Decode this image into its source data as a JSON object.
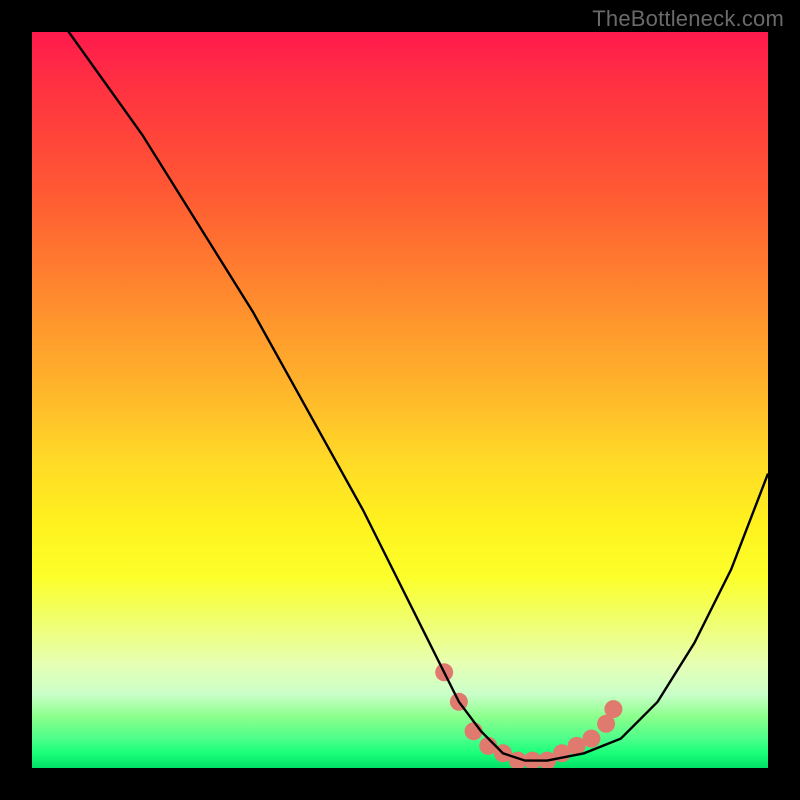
{
  "watermark": "TheBottleneck.com",
  "chart_data": {
    "type": "line",
    "title": "",
    "xlabel": "",
    "ylabel": "",
    "xlim": [
      0,
      100
    ],
    "ylim": [
      0,
      100
    ],
    "series": [
      {
        "name": "bottleneck-curve",
        "x": [
          0,
          5,
          10,
          15,
          20,
          25,
          30,
          35,
          40,
          45,
          50,
          55,
          58,
          61,
          64,
          67,
          70,
          75,
          80,
          85,
          90,
          95,
          100
        ],
        "values": [
          105,
          100,
          93,
          86,
          78,
          70,
          62,
          53,
          44,
          35,
          25,
          15,
          9,
          5,
          2,
          1,
          1,
          2,
          4,
          9,
          17,
          27,
          40
        ]
      }
    ],
    "markers": {
      "name": "floor-dots",
      "color": "#e07a6e",
      "points": [
        {
          "x": 56,
          "y": 13
        },
        {
          "x": 58,
          "y": 9
        },
        {
          "x": 60,
          "y": 5
        },
        {
          "x": 62,
          "y": 3
        },
        {
          "x": 64,
          "y": 2
        },
        {
          "x": 66,
          "y": 1
        },
        {
          "x": 68,
          "y": 1
        },
        {
          "x": 70,
          "y": 1
        },
        {
          "x": 72,
          "y": 2
        },
        {
          "x": 74,
          "y": 3
        },
        {
          "x": 76,
          "y": 4
        },
        {
          "x": 78,
          "y": 6
        },
        {
          "x": 79,
          "y": 8
        }
      ]
    },
    "colors": {
      "curve": "#000000",
      "marker": "#e07a6e",
      "bg_top": "#ff1f4d",
      "bg_bottom": "#00e066"
    }
  }
}
